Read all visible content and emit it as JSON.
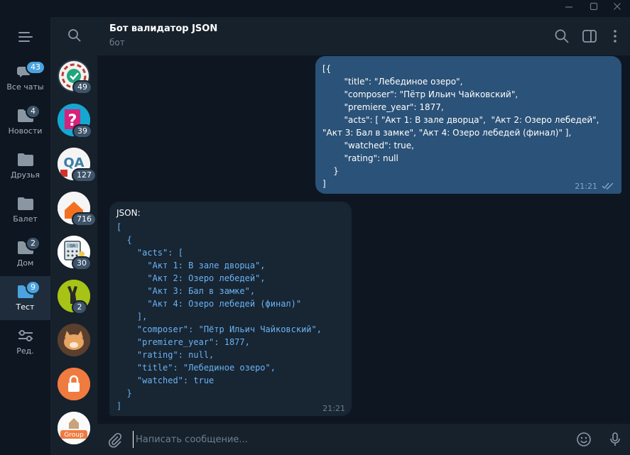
{
  "window": {
    "minimize_icon": "minimize-icon",
    "maximize_icon": "maximize-icon",
    "close_icon": "close-icon"
  },
  "folders": [
    {
      "label": "Все чаты",
      "badge": "43",
      "icon": "chats-icon",
      "active": false
    },
    {
      "label": "Новости",
      "badge": "4",
      "icon": "folder-icon",
      "active": false
    },
    {
      "label": "Друзья",
      "badge": "",
      "icon": "folder-icon",
      "active": false
    },
    {
      "label": "Балет",
      "badge": "",
      "icon": "folder-icon",
      "active": false
    },
    {
      "label": "Дом",
      "badge": "2",
      "icon": "folder-icon",
      "active": false
    },
    {
      "label": "Тест",
      "badge": "9",
      "icon": "folder-icon",
      "active": true
    },
    {
      "label": "Ред.",
      "badge": "",
      "icon": "edit-filters-icon",
      "active": false
    }
  ],
  "chats": [
    {
      "badge": "49"
    },
    {
      "badge": "39"
    },
    {
      "badge": "127",
      "avatar_text": "QA"
    },
    {
      "badge": "716"
    },
    {
      "badge": "30",
      "avatar_text": "QA"
    },
    {
      "badge": "2"
    },
    {
      "badge": ""
    },
    {
      "badge": ""
    },
    {
      "badge": "",
      "avatar_text": "Group"
    }
  ],
  "header": {
    "title": "Бот валидатор JSON",
    "status": "бот"
  },
  "messages": {
    "outgoing": {
      "text": "[{\n        \"title\": \"Лебединое озеро\",\n        \"composer\": \"Пётр Ильич Чайковский\",\n        \"premiere_year\": 1877,\n        \"acts\": [ \"Акт 1: В зале дворца\",  \"Акт 2: Озеро лебедей\", \"Акт 3: Бал в замке\", \"Акт 4: Озеро лебедей (финал)\" ],\n        \"watched\": true,\n        \"rating\": null\n    }\n]",
      "time": "21:21"
    },
    "incoming": {
      "heading": "JSON:",
      "code": "[\n  {\n    \"acts\": [\n      \"Акт 1: В зале дворца\",\n      \"Акт 2: Озеро лебедей\",\n      \"Акт 3: Бал в замке\",\n      \"Акт 4: Озеро лебедей (финал)\"\n    ],\n    \"composer\": \"Пётр Ильич Чайковский\",\n    \"premiere_year\": 1877,\n    \"rating\": null,\n    \"title\": \"Лебединое озеро\",\n    \"watched\": true\n  }\n]",
      "time": "21:21"
    }
  },
  "composer": {
    "placeholder": "Написать сообщение..."
  },
  "colors": {
    "background": "#0e1621",
    "panel": "#17212b",
    "outgoing_bubble": "#2b5278",
    "incoming_bubble": "#182533",
    "accent": "#4aa3df",
    "code": "#6ab3f3"
  }
}
